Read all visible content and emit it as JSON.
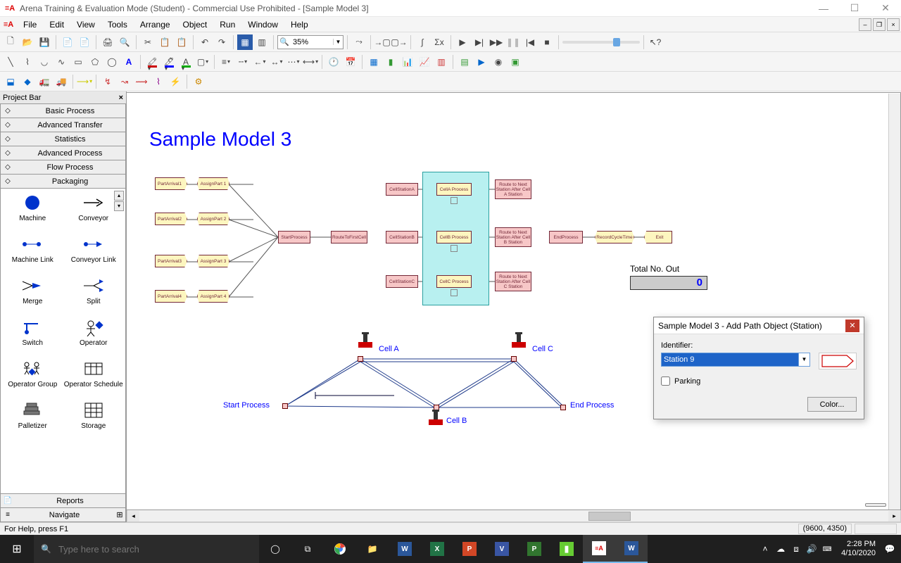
{
  "window": {
    "title": "Arena Training & Evaluation Mode (Student) - Commercial Use Prohibited - [Sample Model 3]",
    "minimize": "—",
    "maximize": "☐",
    "close": "✕"
  },
  "menu": {
    "items": [
      "File",
      "Edit",
      "View",
      "Tools",
      "Arrange",
      "Object",
      "Run",
      "Window",
      "Help"
    ]
  },
  "zoom": {
    "value": "35%"
  },
  "projectbar": {
    "title": "Project Bar",
    "panels": [
      "Basic Process",
      "Advanced Transfer",
      "Statistics",
      "Advanced Process",
      "Flow Process",
      "Packaging"
    ],
    "modules": [
      {
        "label": "Machine",
        "shape": "circle-blue"
      },
      {
        "label": "Conveyor",
        "shape": "arrow"
      },
      {
        "label": "Machine Link",
        "shape": "dots-blue"
      },
      {
        "label": "Conveyor Link",
        "shape": "dots-arrow"
      },
      {
        "label": "Merge",
        "shape": "merge"
      },
      {
        "label": "Split",
        "shape": "split"
      },
      {
        "label": "Switch",
        "shape": "switch"
      },
      {
        "label": "Operator",
        "shape": "operator"
      },
      {
        "label": "Operator Group",
        "shape": "opgroup"
      },
      {
        "label": "Operator Schedule",
        "shape": "schedule"
      },
      {
        "label": "Palletizer",
        "shape": "palletizer"
      },
      {
        "label": "Storage",
        "shape": "storage"
      }
    ],
    "bottom_panels": [
      "Reports",
      "Navigate"
    ]
  },
  "model": {
    "title": "Sample Model 3",
    "arrivals": [
      {
        "a": "PartArrival1",
        "b": "AssignPart 1"
      },
      {
        "a": "PartArrival2",
        "b": "AssignPart 2"
      },
      {
        "a": "PartArrival3",
        "b": "AssignPart 3"
      },
      {
        "a": "PartArrival4",
        "b": "AssignPart 4"
      }
    ],
    "start": "StartProcess",
    "route1": "RouteToFirstCell",
    "stations": [
      "CellStationA",
      "CellStationB",
      "CellStationC"
    ],
    "processes": [
      "CellA Process",
      "CellB Process",
      "CellC Process"
    ],
    "routes": [
      "Route to Next Station After Cell A Station",
      "Route to Next Station After Cell B Station",
      "Route to Next Station After Cell C Station"
    ],
    "end": "EndProcess",
    "record": "RecordCycleTime",
    "exit": "Exit",
    "counter_label": "Total No. Out",
    "counter_value": "0",
    "net": {
      "cells": [
        "Cell A",
        "Cell B",
        "Cell C"
      ],
      "start": "Start Process",
      "end": "End Process"
    }
  },
  "dialog": {
    "title": "Sample Model 3 - Add Path Object (Station)",
    "identifier_label": "Identifier:",
    "identifier_value": "Station 9",
    "parking_label": "Parking",
    "color_button": "Color..."
  },
  "status": {
    "left": "For Help, press F1",
    "coords": "(9600, 4350)"
  },
  "taskbar": {
    "search_placeholder": "Type here to search",
    "time": "2:28 PM",
    "date": "4/10/2020"
  }
}
